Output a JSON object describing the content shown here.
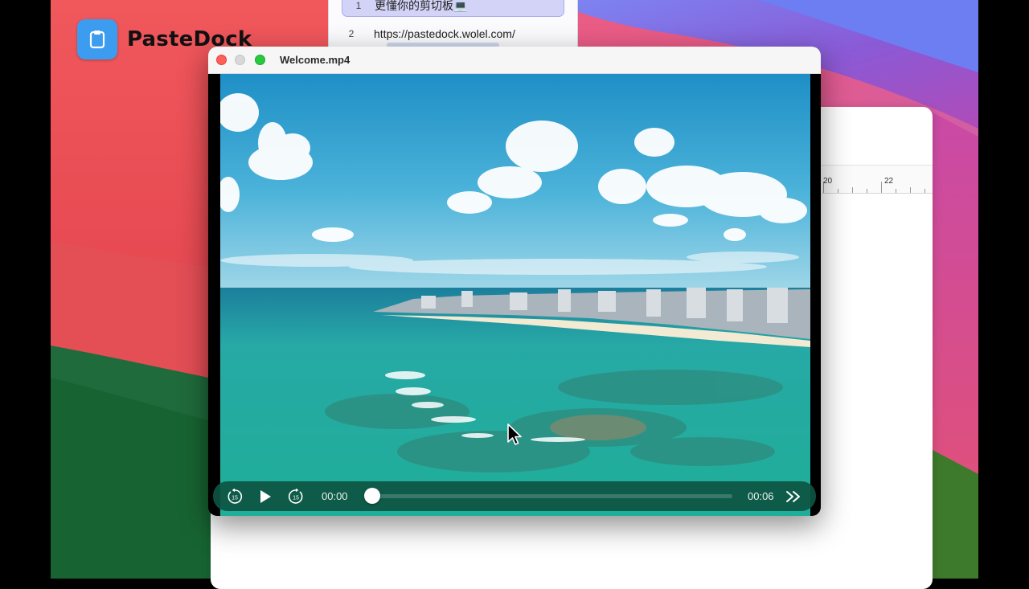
{
  "brand": {
    "name": "PasteDock",
    "icon": "clipboard-icon",
    "icon_color": "#3b9cf0"
  },
  "clipboard_list": {
    "items": [
      {
        "index": "1",
        "text": "更懂你的剪切板💻"
      },
      {
        "index": "2",
        "text": "https://pastedock.wolel.com/"
      }
    ]
  },
  "document": {
    "ruler_labels": [
      "20",
      "22"
    ]
  },
  "player": {
    "title": "Welcome.mp4",
    "current_time": "00:00",
    "duration": "00:06",
    "progress": 0,
    "controls": {
      "rewind": "rewind-15-icon",
      "play": "play-icon",
      "forward": "forward-15-icon",
      "skip": "skip-forward-icon"
    }
  },
  "colors": {
    "wallpaper_red": "#e8434f",
    "wallpaper_purple": "#8a57d6",
    "controls_bg": "#0e5442",
    "close": "#fe5f57",
    "maximize": "#28c840"
  }
}
